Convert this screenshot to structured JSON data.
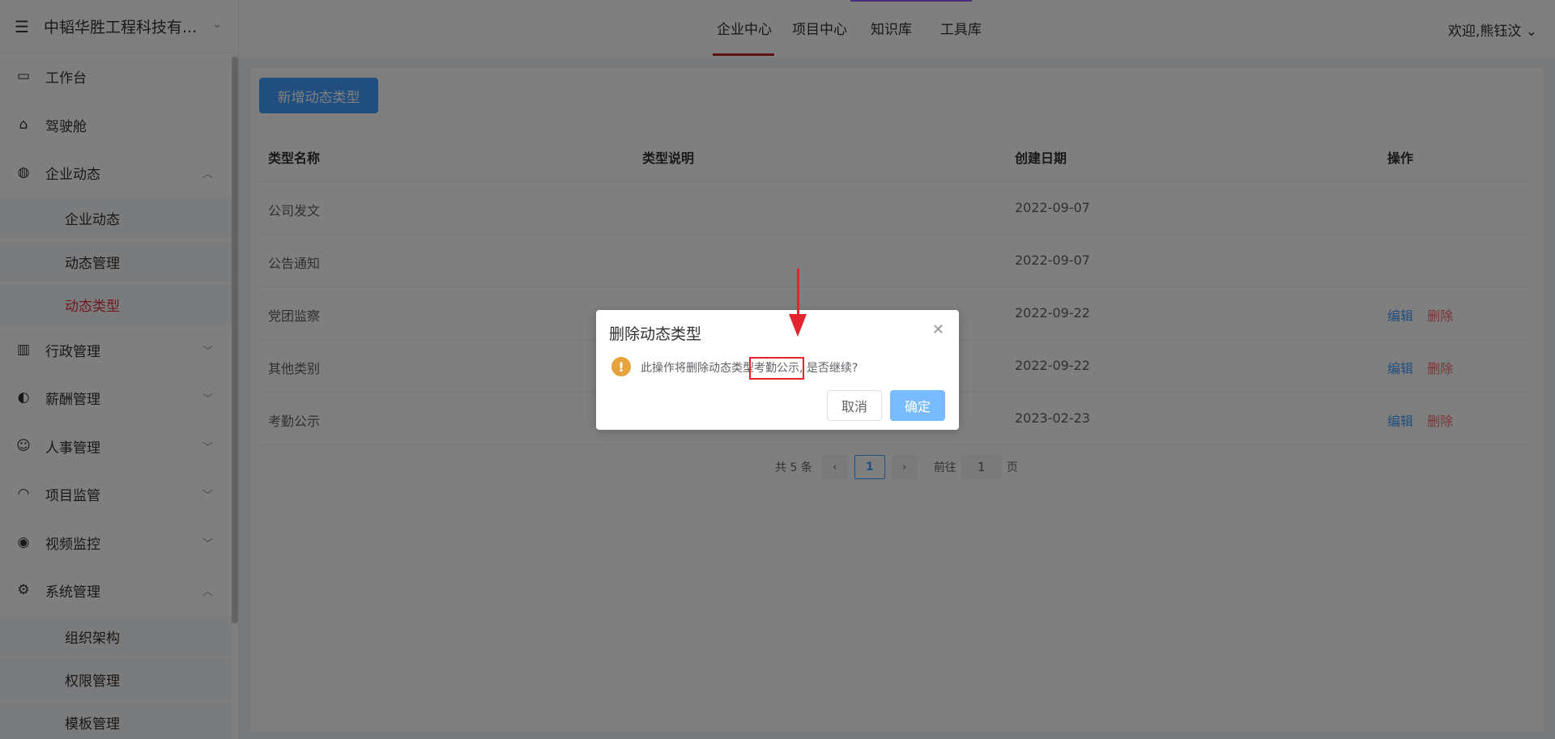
{
  "sidebar": {
    "brand": "中韬华胜工程科技有...",
    "menu": [
      {
        "label": "工作台",
        "icon": "monitor-icon"
      },
      {
        "label": "驾驶舱",
        "icon": "home-icon"
      },
      {
        "label": "企业动态",
        "icon": "globe-icon",
        "expanded": true
      },
      {
        "label": "行政管理",
        "icon": "building-icon"
      },
      {
        "label": "薪酬管理",
        "icon": "salary-icon"
      },
      {
        "label": "人事管理",
        "icon": "people-icon"
      },
      {
        "label": "项目监管",
        "icon": "helmet-icon"
      },
      {
        "label": "视频监控",
        "icon": "camera-icon"
      },
      {
        "label": "系统管理",
        "icon": "settings-icon",
        "expanded": true
      }
    ],
    "sub_news": [
      "企业动态",
      "动态管理",
      "动态类型"
    ],
    "sub_system": [
      "组织架构",
      "权限管理",
      "模板管理"
    ]
  },
  "topnav": {
    "tabs": [
      "企业中心",
      "项目中心",
      "知识库",
      "工具库"
    ],
    "active_tab": "企业中心",
    "welcome": "欢迎,熊钰汶"
  },
  "main": {
    "add_button": "新增动态类型",
    "columns": [
      "类型名称",
      "类型说明",
      "创建日期",
      "操作"
    ],
    "rows": [
      {
        "name": "公司发文",
        "desc": "",
        "date": "2022-09-07",
        "edit": "",
        "delete": ""
      },
      {
        "name": "公告通知",
        "desc": "",
        "date": "2022-09-07",
        "edit": "",
        "delete": ""
      },
      {
        "name": "党团监察",
        "desc": "",
        "date": "2022-09-22",
        "edit": "编辑",
        "delete": "删除"
      },
      {
        "name": "其他类别",
        "desc": "",
        "date": "2022-09-22",
        "edit": "编辑",
        "delete": "删除"
      },
      {
        "name": "考勤公示",
        "desc": "",
        "date": "2023-02-23",
        "edit": "编辑",
        "delete": "删除"
      }
    ],
    "pagination": {
      "total": "共 5 条",
      "current_page": "1",
      "goto_label": "前往",
      "goto_value": "1",
      "page_suffix": "页"
    }
  },
  "dialog": {
    "title": "删除动态类型",
    "message_prefix": "此操作将删除动态类型",
    "message_highlight": "考勤公示",
    "message_suffix": ", 是否继续?",
    "cancel": "取消",
    "confirm": "确定"
  },
  "colors": {
    "primary": "#409eff",
    "danger": "#f56c6c",
    "active_menu": "#e0333d",
    "annotation": "#e3262d",
    "warning": "#e6a23c"
  }
}
